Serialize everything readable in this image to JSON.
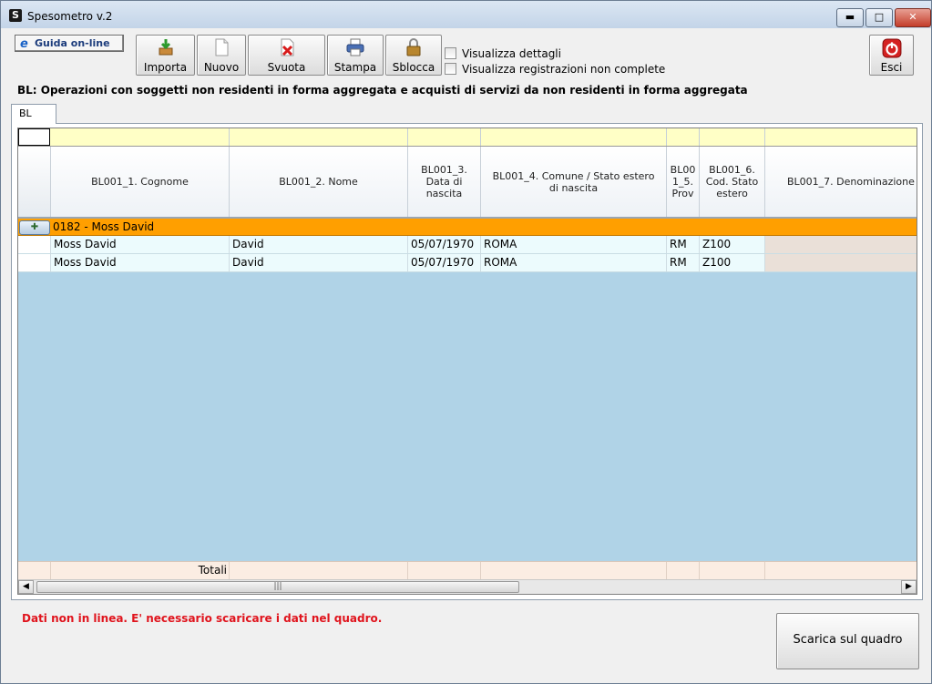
{
  "window": {
    "title": "Spesometro v.2",
    "app_icon": "S"
  },
  "toolbar": {
    "guida_label": "Guida on-line",
    "buttons": [
      "Importa",
      "Nuovo",
      "Svuota",
      "Stampa",
      "Sblocca"
    ],
    "exit_label": "Esci"
  },
  "options": {
    "show_details": "Visualizza dettagli",
    "show_incomplete": "Visualizza registrazioni non complete"
  },
  "section_title": "BL: Operazioni con soggetti non residenti in forma aggregata e acquisti di servizi da non residenti in forma aggregata",
  "tabs": [
    "BL"
  ],
  "grid": {
    "columns": [
      "BL001_1. Cognome",
      "BL001_2. Nome",
      "BL001_3.\nData di\nnascita",
      "BL001_4. Comune / Stato estero\ndi nascita",
      "BL00\n1_5.\nProv",
      "BL001_6.\nCod. Stato\nestero",
      "BL001_7. Denominazione"
    ],
    "group_label": "0182 - Moss David",
    "rows": [
      [
        "Moss David",
        "David",
        "05/07/1970",
        "ROMA",
        "RM",
        "Z100",
        ""
      ],
      [
        "Moss David",
        "David",
        "05/07/1970",
        "ROMA",
        "RM",
        "Z100",
        ""
      ]
    ],
    "totals_label": "Totali"
  },
  "status": {
    "message": "Dati non in linea. E' necessario scaricare i dati nel quadro.",
    "download_button": "Scarica sul quadro"
  },
  "colors": {
    "group_row": "#ff9f00",
    "grid_empty": "#b0d3e7",
    "filter_row": "#ffffc6",
    "status_text": "#e0141d"
  }
}
